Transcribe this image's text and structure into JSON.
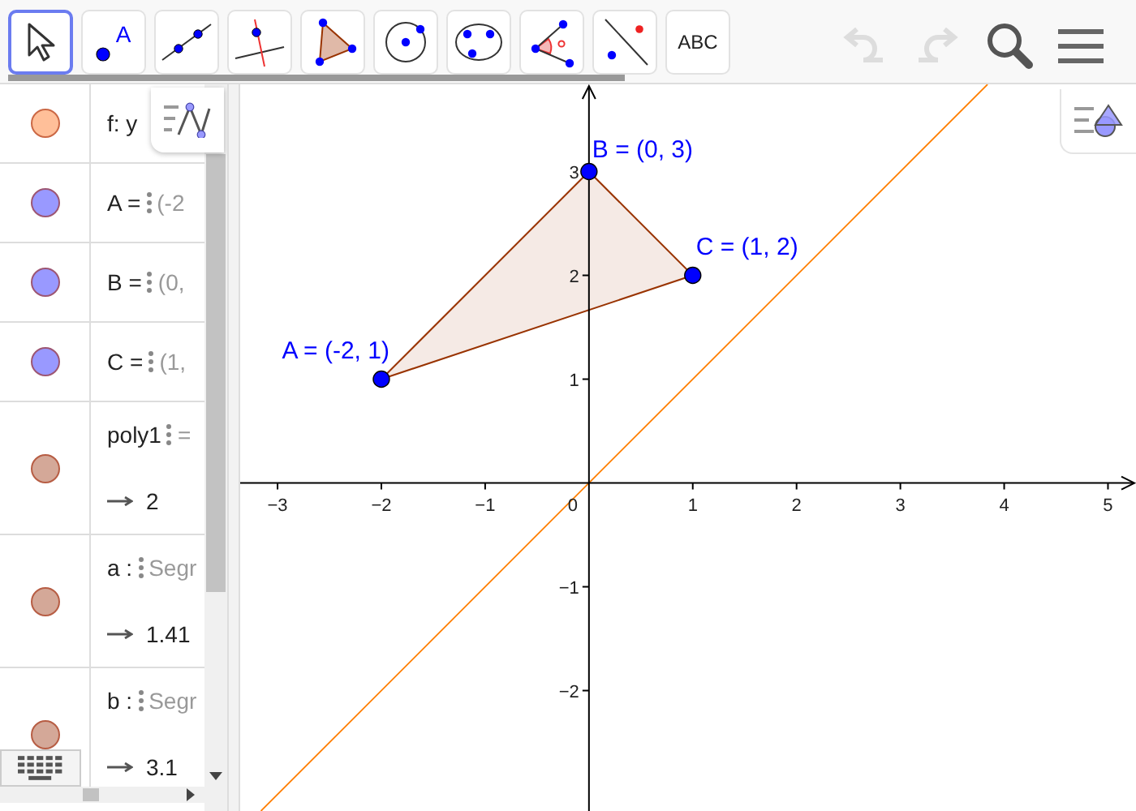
{
  "toolbar": {
    "tools": [
      {
        "kind": "move",
        "selected": true
      },
      {
        "kind": "point",
        "label": "A",
        "selected": false
      },
      {
        "kind": "line",
        "selected": false
      },
      {
        "kind": "perpendicular",
        "selected": false
      },
      {
        "kind": "polygon",
        "selected": false
      },
      {
        "kind": "circle",
        "selected": false
      },
      {
        "kind": "conic",
        "selected": false
      },
      {
        "kind": "angle",
        "selected": false
      },
      {
        "kind": "reflect",
        "selected": false
      },
      {
        "kind": "text",
        "label": "ABC",
        "selected": false
      }
    ],
    "undo": {
      "disabled": true
    },
    "redo": {
      "disabled": true
    }
  },
  "algebra": {
    "items": [
      {
        "color": "#ffbf99",
        "label": "f: y"
      },
      {
        "color": "#9999ff",
        "label": "A =",
        "preview": "(-2"
      },
      {
        "color": "#9999ff",
        "label": "B =",
        "preview": "(0,"
      },
      {
        "color": "#9999ff",
        "label": "C =",
        "preview": "(1,"
      },
      {
        "color": "#d4a898",
        "label": "poly1",
        "preview": "=",
        "result": "2"
      },
      {
        "color": "#d4a898",
        "label": "a :",
        "preview": "Segr",
        "result": "1.41"
      },
      {
        "color": "#d4a898",
        "label": "b :",
        "preview": "Segr",
        "result": "3.1"
      }
    ]
  },
  "graphics": {
    "origin_label": "0",
    "objects": [
      {
        "kind": "polygon",
        "color": "#993300"
      },
      {
        "kind": "line",
        "color": "#ff7f00"
      }
    ],
    "chart_data": {
      "type": "scatter",
      "x": [
        -2,
        0,
        1
      ],
      "series": [
        {
          "color": "#0000ff",
          "values": [
            1,
            3,
            2
          ]
        }
      ],
      "xlim": [
        -3.36,
        5.27
      ],
      "ylim": [
        -3.16,
        3.84
      ],
      "xticks": [
        {
          "value": -3,
          "label": "−3"
        },
        {
          "value": -2,
          "label": "−2"
        },
        {
          "value": -1,
          "label": "−1"
        },
        1,
        2,
        3,
        4,
        5
      ],
      "yticks": [
        {
          "value": -2,
          "label": "−2"
        },
        {
          "value": -1,
          "label": "−1"
        },
        1,
        2,
        3
      ],
      "value_labels": [
        "A = (-2, 1)",
        "B = (0, 3)",
        "C = (1, 2)"
      ]
    }
  }
}
